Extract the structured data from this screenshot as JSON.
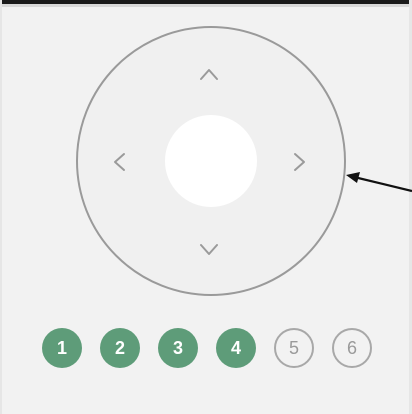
{
  "dpad": {
    "icons": {
      "up": "chevron-up-icon",
      "down": "chevron-down-icon",
      "left": "chevron-left-icon",
      "right": "chevron-right-icon",
      "pointer": "arrow-left-icon"
    },
    "ring_color": "#9a9a9a",
    "chevron_color": "#9a9a9a",
    "center_color": "#ffffff"
  },
  "steps": {
    "completed_color": "#5e9c79",
    "items": [
      {
        "label": "1",
        "completed": true
      },
      {
        "label": "2",
        "completed": true
      },
      {
        "label": "3",
        "completed": true
      },
      {
        "label": "4",
        "completed": true
      },
      {
        "label": "5",
        "completed": false
      },
      {
        "label": "6",
        "completed": false
      }
    ]
  }
}
